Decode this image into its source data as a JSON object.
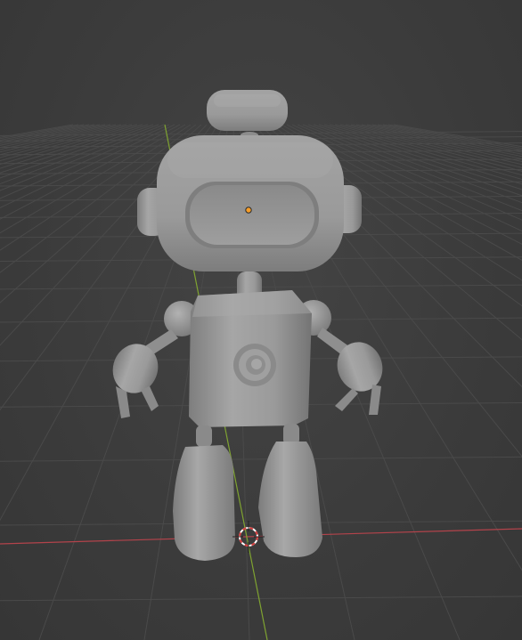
{
  "app": {
    "name": "3D Viewport",
    "view_mode": "solid"
  },
  "scene": {
    "background_color": "#3d3d3d",
    "grid_color": "#4a4a4a",
    "x_axis_color": "#b3434b",
    "y_axis_color": "#7fa331",
    "origin_color": "#f79d28",
    "cursor_colors": [
      "#d43b3b",
      "#ffffff"
    ],
    "model": {
      "type": "robot-character",
      "material_color": "#9a9a9a",
      "parts": [
        "antenna",
        "head",
        "visor",
        "ear-left",
        "ear-right",
        "neck",
        "torso",
        "chest-button",
        "shoulder-left",
        "shoulder-right",
        "arm-left",
        "arm-right",
        "hand-left",
        "hand-right",
        "leg-left",
        "leg-right",
        "foot-left",
        "foot-right"
      ]
    },
    "icons": [
      "3d-cursor-icon",
      "origin-point-icon"
    ]
  }
}
